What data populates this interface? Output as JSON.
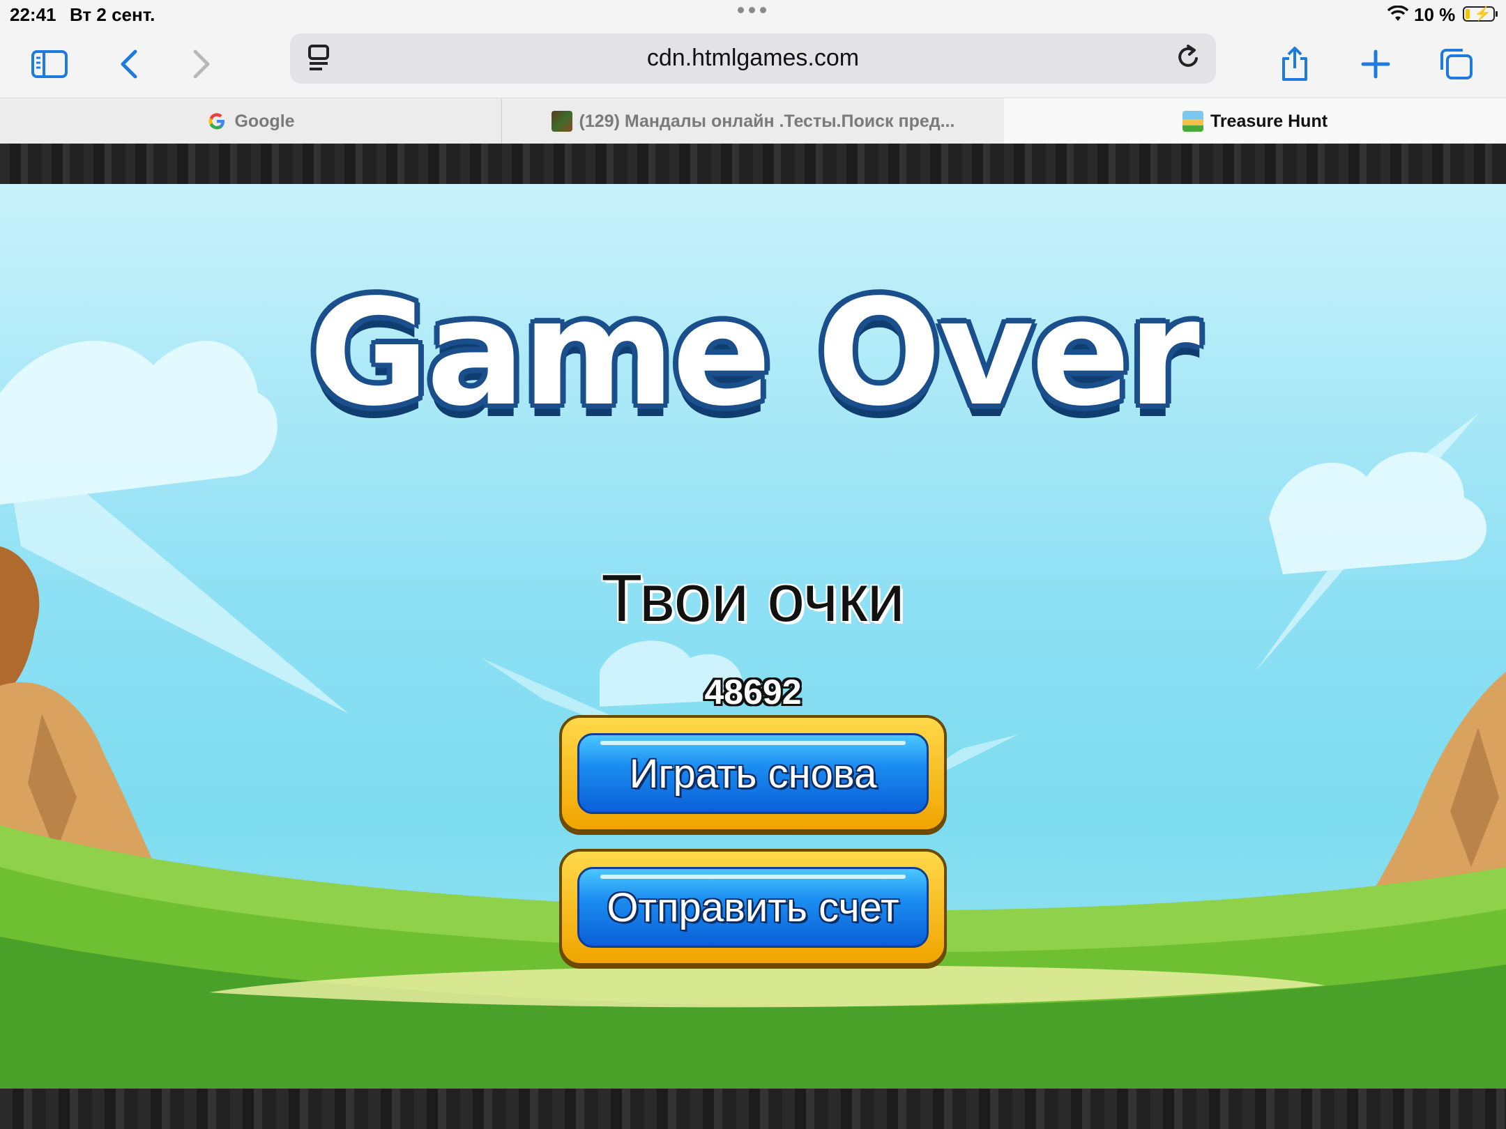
{
  "status_bar": {
    "time": "22:41",
    "date": "Вт 2 сент.",
    "battery_percent": "10 %"
  },
  "toolbar": {
    "url": "cdn.htmlgames.com",
    "icons": [
      "sidebar-icon",
      "back-icon",
      "forward-icon",
      "reader-icon",
      "reload-icon",
      "share-icon",
      "new-tab-icon",
      "tabs-icon"
    ]
  },
  "tabs": [
    {
      "label": "Google",
      "active": false
    },
    {
      "label": "(129) Мандалы онлайн .Тесты.Поиск пред...",
      "active": false
    },
    {
      "label": "Treasure Hunt",
      "active": true
    }
  ],
  "game": {
    "title": "Game Over",
    "score_label": "Твои очки",
    "score": "48692",
    "buttons": {
      "play_again": "Играть снова",
      "submit_score": "Отправить счет"
    },
    "colors": {
      "title_outline": "#1a4f8c",
      "button_frame": "#f0a400",
      "button_face": "#1b8df0"
    }
  }
}
